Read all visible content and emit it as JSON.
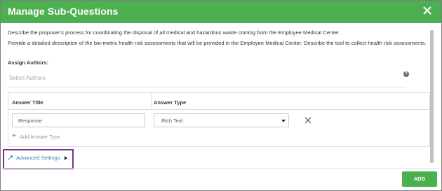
{
  "dialog": {
    "title": "Manage Sub-Questions"
  },
  "description": {
    "line1": "Describe the proposer's process for coordinating the disposal of all medical and hazardous waste coming from the Employee Medical Center.",
    "line2": "Provide a detailed description of the bio-metric health risk assessments that will be provided in the Employee Medical Center. Describe the tool to collect health risk assessments."
  },
  "authors": {
    "label": "Assign Authors:",
    "placeholder": "Select Authors",
    "help": "?"
  },
  "answers_table": {
    "columns": [
      "Answer Title",
      "Answer Type"
    ],
    "rows": [
      {
        "title": "Response",
        "type": "Rich Text"
      }
    ],
    "add_label": "Add Answer Type"
  },
  "advanced": {
    "label": "Advanced Settings"
  },
  "footer": {
    "add_label": "ADD"
  },
  "colors": {
    "header": "#4caf50",
    "add_button": "#4caf50",
    "link": "#337ab7",
    "highlight": "#7e2f8e"
  },
  "icons": {
    "close": "close-icon",
    "help": "question-circle-icon",
    "remove_row": "close-icon",
    "add": "plus-icon",
    "advanced": "wrench-icon",
    "expand": "caret-right-icon"
  }
}
